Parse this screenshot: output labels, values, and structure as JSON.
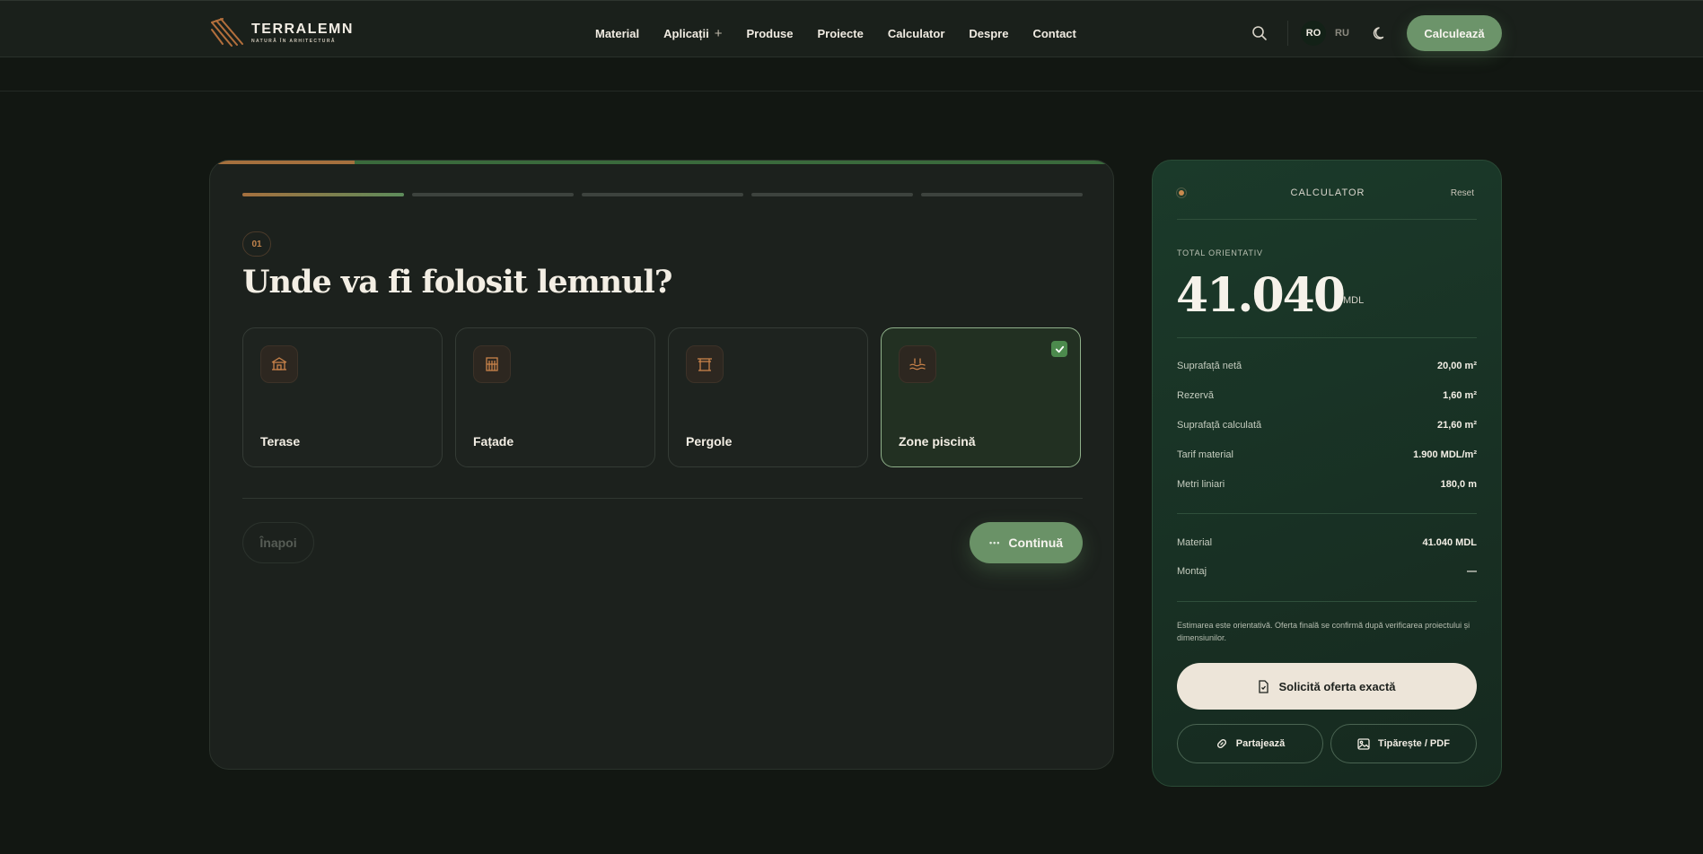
{
  "brand": {
    "name": "TERRALEMN",
    "tagline": "NATURĂ ÎN ARHITECTURĂ"
  },
  "nav": {
    "items": [
      {
        "label": "Material"
      },
      {
        "label": "Aplicații",
        "has_submenu": true,
        "plus": "+"
      },
      {
        "label": "Produse"
      },
      {
        "label": "Proiecte"
      },
      {
        "label": "Calculator"
      },
      {
        "label": "Despre"
      },
      {
        "label": "Contact"
      }
    ],
    "languages": [
      "RO",
      "RU"
    ],
    "active_language": "RO",
    "cta_label": "Calculează"
  },
  "wizard": {
    "progress_fraction": 0.16,
    "steps_total": 5,
    "current_step": 1,
    "step_number": "01",
    "question": "Unde va fi folosit lemnul?",
    "options": [
      {
        "label": "Terase",
        "icon": "pavilion-icon",
        "selected": false
      },
      {
        "label": "Fațade",
        "icon": "building-icon",
        "selected": false
      },
      {
        "label": "Pergole",
        "icon": "pergola-icon",
        "selected": false
      },
      {
        "label": "Zone piscină",
        "icon": "pool-icon",
        "selected": true
      }
    ],
    "back_label": "Înapoi",
    "next_label": "Continuă",
    "next_dots": "•••"
  },
  "calculator": {
    "title": "CALCULATOR",
    "reset_label": "Reset",
    "total_label": "TOTAL ORIENTATIV",
    "total_value": "41.040",
    "total_unit": "MDL",
    "metrics": [
      {
        "label": "Suprafață netă",
        "value": "20,00 m²"
      },
      {
        "label": "Rezervă",
        "value": "1,60 m²"
      },
      {
        "label": "Suprafață calculată",
        "value": "21,60 m²"
      },
      {
        "label": "Tarif material",
        "value": "1.900 MDL/m²"
      },
      {
        "label": "Metri liniari",
        "value": "180,0 m"
      }
    ],
    "costs": [
      {
        "label": "Material",
        "value": "41.040 MDL"
      },
      {
        "label": "Montaj",
        "value": "—"
      }
    ],
    "note": "Estimarea este orientativă. Oferta finală se confirmă după verificarea proiectului și dimensiunilor.",
    "request_label": "Solicită oferta exactă",
    "share_label": "Partajează",
    "print_label": "Tipărește / PDF"
  },
  "colors": {
    "background": "#121712",
    "accent_green": "#6c946a",
    "accent_copper": "#a5703e",
    "calc_panel": "#183025",
    "cream_button": "#ede5d9"
  }
}
